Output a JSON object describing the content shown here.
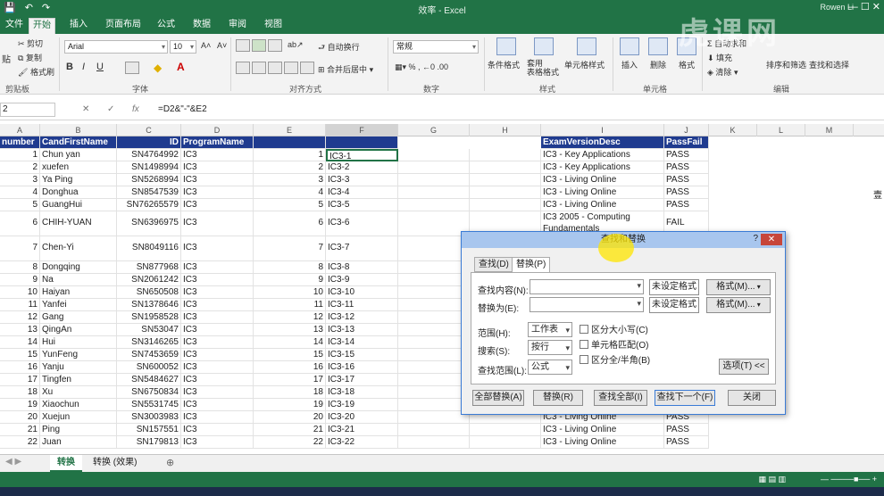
{
  "window": {
    "title": "效率 - Excel",
    "user": "Rowen Li",
    "quick_access": [
      "💾",
      "↶",
      "↷"
    ]
  },
  "tabs": [
    "文件",
    "开始",
    "插入",
    "页面布局",
    "公式",
    "数据",
    "审阅",
    "视图"
  ],
  "ribbon": {
    "clipboard": {
      "cut": "剪切",
      "copy": "复制",
      "painter": "格式刷",
      "paste": "贴",
      "group": "剪贴板"
    },
    "font": {
      "name": "Arial",
      "size": "10",
      "grow": "A˄",
      "shrink": "A˅",
      "bold": "B",
      "italic": "I",
      "underline": "U",
      "group": "字体"
    },
    "alignment": {
      "wrap": "自动换行",
      "merge": "合并后居中",
      "group": "对齐方式"
    },
    "number": {
      "format": "常规",
      "group": "数字"
    },
    "styles": {
      "conditional": "条件格式",
      "table": "套用\n表格格式",
      "cell": "单元格样式",
      "group": "样式"
    },
    "cells": {
      "insert": "插入",
      "delete": "删除",
      "format": "格式",
      "group": "单元格"
    },
    "editing": {
      "autosum": "自动求和",
      "fill": "填充",
      "clear": "清除",
      "sort": "排序和筛选",
      "find": "查找和选择",
      "group": "编辑"
    }
  },
  "formula_bar": {
    "namebox": "2",
    "formula": "=D2&\"-\"&E2"
  },
  "columns": [
    "A",
    "B",
    "C",
    "D",
    "E",
    "F",
    "G",
    "H",
    "I",
    "J",
    "K",
    "L",
    "M"
  ],
  "headers": {
    "A": "number",
    "B": "CandFirstName",
    "C": "ID",
    "D": "ProgramName",
    "I": "ExamVersionDesc",
    "J": "PassFail"
  },
  "rows": [
    {
      "n": "1",
      "name": "Chun yan",
      "id": "SN4764992",
      "prog": "IC3",
      "e": "1",
      "f": "IC3-1",
      "exam": "IC3 - Key Applications",
      "pf": "PASS"
    },
    {
      "n": "2",
      "name": "xuefen",
      "id": "SN1498994",
      "prog": "IC3",
      "e": "2",
      "f": "IC3-2",
      "exam": "IC3 - Key Applications",
      "pf": "PASS"
    },
    {
      "n": "3",
      "name": "Ya Ping",
      "id": "SN5268994",
      "prog": "IC3",
      "e": "3",
      "f": "IC3-3",
      "exam": "IC3 - Living Online",
      "pf": "PASS"
    },
    {
      "n": "4",
      "name": "Donghua",
      "id": "SN8547539",
      "prog": "IC3",
      "e": "4",
      "f": "IC3-4",
      "exam": "IC3 - Living Online",
      "pf": "PASS"
    },
    {
      "n": "5",
      "name": "GuangHui",
      "id": "SN76265579",
      "prog": "IC3",
      "e": "5",
      "f": "IC3-5",
      "exam": "IC3 - Living Online",
      "pf": "PASS"
    },
    {
      "n": "6",
      "name": "CHIH-YUAN",
      "id": "SN6396975",
      "prog": "IC3",
      "e": "6",
      "f": "IC3-6",
      "exam": "IC3 2005 - Computing Fundamentals",
      "pf": "FAIL"
    },
    {
      "n": "7",
      "name": "Chen-Yi",
      "id": "SN8049116",
      "prog": "IC3",
      "e": "7",
      "f": "IC3-7",
      "exam": "",
      "pf": ""
    },
    {
      "n": "8",
      "name": "Dongqing",
      "id": "SN877968",
      "prog": "IC3",
      "e": "8",
      "f": "IC3-8",
      "exam": "",
      "pf": ""
    },
    {
      "n": "9",
      "name": "Na",
      "id": "SN2061242",
      "prog": "IC3",
      "e": "9",
      "f": "IC3-9",
      "exam": "",
      "pf": ""
    },
    {
      "n": "10",
      "name": "Haiyan",
      "id": "SN650508",
      "prog": "IC3",
      "e": "10",
      "f": "IC3-10",
      "exam": "",
      "pf": ""
    },
    {
      "n": "11",
      "name": "Yanfei",
      "id": "SN1378646",
      "prog": "IC3",
      "e": "11",
      "f": "IC3-11",
      "exam": "",
      "pf": ""
    },
    {
      "n": "12",
      "name": "Gang",
      "id": "SN1958528",
      "prog": "IC3",
      "e": "12",
      "f": "IC3-12",
      "exam": "",
      "pf": ""
    },
    {
      "n": "13",
      "name": "QingAn",
      "id": "SN53047",
      "prog": "IC3",
      "e": "13",
      "f": "IC3-13",
      "exam": "",
      "pf": ""
    },
    {
      "n": "14",
      "name": "Hui",
      "id": "SN3146265",
      "prog": "IC3",
      "e": "14",
      "f": "IC3-14",
      "exam": "",
      "pf": ""
    },
    {
      "n": "15",
      "name": "YunFeng",
      "id": "SN7453659",
      "prog": "IC3",
      "e": "15",
      "f": "IC3-15",
      "exam": "",
      "pf": ""
    },
    {
      "n": "16",
      "name": "Yanju",
      "id": "SN600052",
      "prog": "IC3",
      "e": "16",
      "f": "IC3-16",
      "exam": "",
      "pf": ""
    },
    {
      "n": "17",
      "name": "Tingfen",
      "id": "SN5484627",
      "prog": "IC3",
      "e": "17",
      "f": "IC3-17",
      "exam": "",
      "pf": ""
    },
    {
      "n": "18",
      "name": "Xu",
      "id": "SN6750834",
      "prog": "IC3",
      "e": "18",
      "f": "IC3-18",
      "exam": "",
      "pf": ""
    },
    {
      "n": "19",
      "name": "Xiaochun",
      "id": "SN5531745",
      "prog": "IC3",
      "e": "19",
      "f": "IC3-19",
      "exam": "",
      "pf": ""
    },
    {
      "n": "20",
      "name": "Xuejun",
      "id": "SN3003983",
      "prog": "IC3",
      "e": "20",
      "f": "IC3-20",
      "exam": "IC3 - Living Online",
      "pf": "PASS"
    },
    {
      "n": "21",
      "name": "Ping",
      "id": "SN157551",
      "prog": "IC3",
      "e": "21",
      "f": "IC3-21",
      "exam": "IC3 - Living Online",
      "pf": "PASS"
    },
    {
      "n": "22",
      "name": "Juan",
      "id": "SN179813",
      "prog": "IC3",
      "e": "22",
      "f": "IC3-22",
      "exam": "IC3 - Living Online",
      "pf": "PASS"
    }
  ],
  "sheets": [
    "转换",
    "转换 (效果)"
  ],
  "side_text": "壹",
  "watermark": "虎课网",
  "dialog": {
    "title": "查找和替换",
    "help": "?",
    "close": "✕",
    "tab_find": "查找(D)",
    "tab_replace": "替换(P)",
    "find_label": "查找内容(N):",
    "replace_label": "替换为(E):",
    "no_format": "未设定格式",
    "format_btn": "格式(M)...",
    "scope_label": "范围(H):",
    "scope_value": "工作表",
    "search_label": "搜索(S):",
    "search_value": "按行",
    "lookin_label": "查找范围(L):",
    "lookin_value": "公式",
    "match_case": "区分大小写(C)",
    "match_cell": "单元格匹配(O)",
    "match_width": "区分全/半角(B)",
    "options": "选项(T) <<",
    "replace_all": "全部替换(A)",
    "replace": "替换(R)",
    "find_all": "查找全部(I)",
    "find_next": "查找下一个(F)",
    "close_btn": "关闭"
  }
}
